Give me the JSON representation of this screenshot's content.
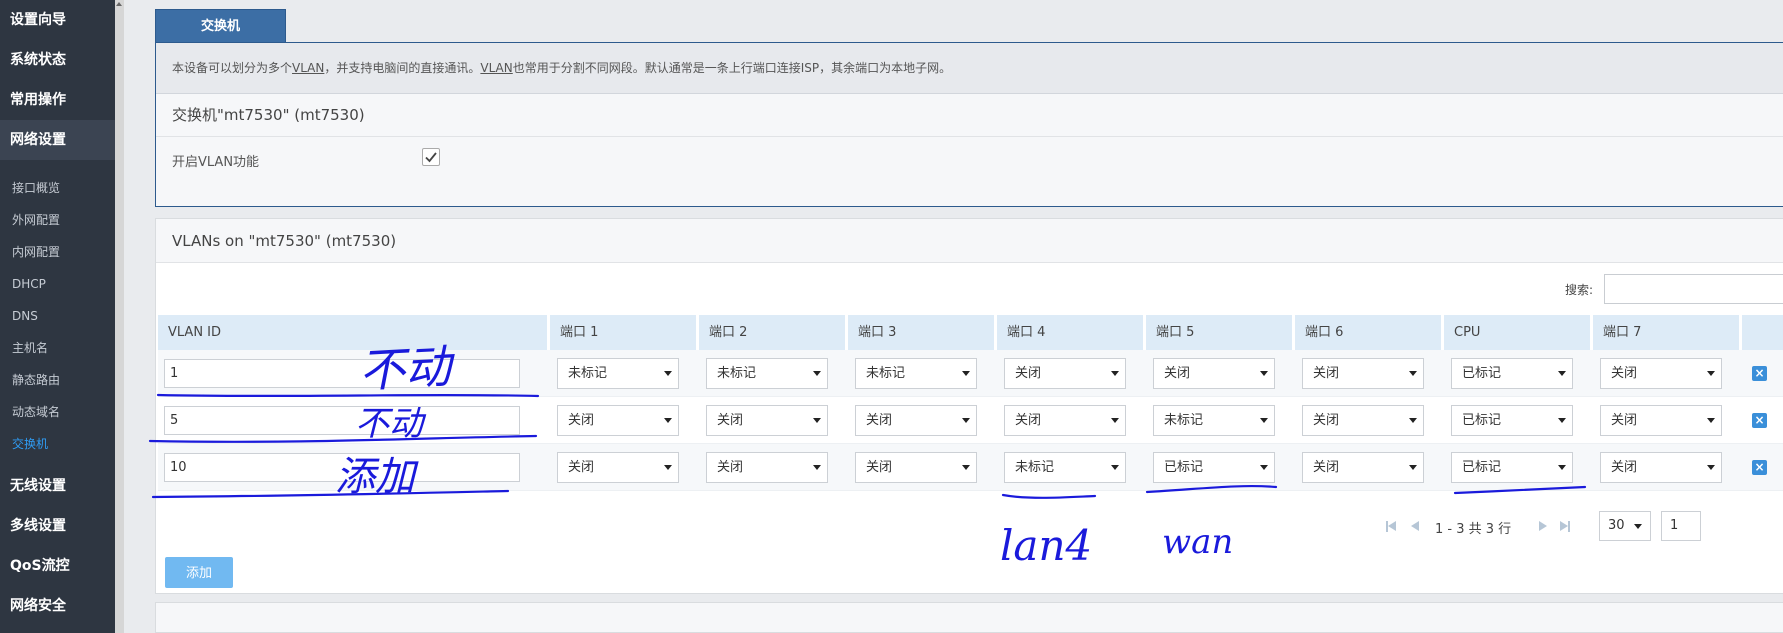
{
  "sidebar": {
    "items": [
      {
        "label": "设置向导"
      },
      {
        "label": "系统状态"
      },
      {
        "label": "常用操作"
      },
      {
        "label": "网络设置"
      }
    ],
    "subitems": [
      {
        "label": "接口概览"
      },
      {
        "label": "外网配置"
      },
      {
        "label": "内网配置"
      },
      {
        "label": "DHCP"
      },
      {
        "label": "DNS"
      },
      {
        "label": "主机名"
      },
      {
        "label": "静态路由"
      },
      {
        "label": "动态域名"
      },
      {
        "label": "交换机"
      }
    ],
    "bottom_items": [
      {
        "label": "无线设置"
      },
      {
        "label": "多线设置"
      },
      {
        "label": "QoS流控"
      },
      {
        "label": "网络安全"
      }
    ]
  },
  "tab": {
    "label": "交换机"
  },
  "description": {
    "p1": "本设备可以划分为多个",
    "u1": "VLAN",
    "p2": "，并支持电脑间的直接通讯。",
    "u2": "VLAN",
    "p3": "也常用于分割不同网段。默认通常是一条上行端口连接ISP，其余端口为本地子网。"
  },
  "switch_section": {
    "title": "交换机\"mt7530\" (mt7530)",
    "enable_vlan_label": "开启VLAN功能",
    "enable_vlan_checked": true
  },
  "vlans": {
    "title": "VLANs on \"mt7530\" (mt7530)",
    "search_label": "搜索:",
    "search_value": "",
    "headers": [
      "VLAN ID",
      "端口 1",
      "端口 2",
      "端口 3",
      "端口 4",
      "端口 5",
      "端口 6",
      "CPU",
      "端口 7"
    ],
    "rows": [
      {
        "id": "1",
        "ports": [
          "未标记",
          "未标记",
          "未标记",
          "关闭",
          "关闭",
          "关闭",
          "已标记",
          "关闭"
        ]
      },
      {
        "id": "5",
        "ports": [
          "关闭",
          "关闭",
          "关闭",
          "关闭",
          "未标记",
          "关闭",
          "已标记",
          "关闭"
        ]
      },
      {
        "id": "10",
        "ports": [
          "关闭",
          "关闭",
          "关闭",
          "未标记",
          "已标记",
          "关闭",
          "已标记",
          "关闭"
        ]
      }
    ],
    "delete_icon": "×",
    "pager": {
      "info": "1 - 3 共 3 行",
      "page_size": "30",
      "page": "1"
    },
    "add_label": "添加"
  },
  "annotations": {
    "row1_note": "不动",
    "row2_note": "不动",
    "row3_note": "添加",
    "port4_note": "lan4",
    "port5_note": "wan",
    "ink_color": "#1a1adb"
  }
}
